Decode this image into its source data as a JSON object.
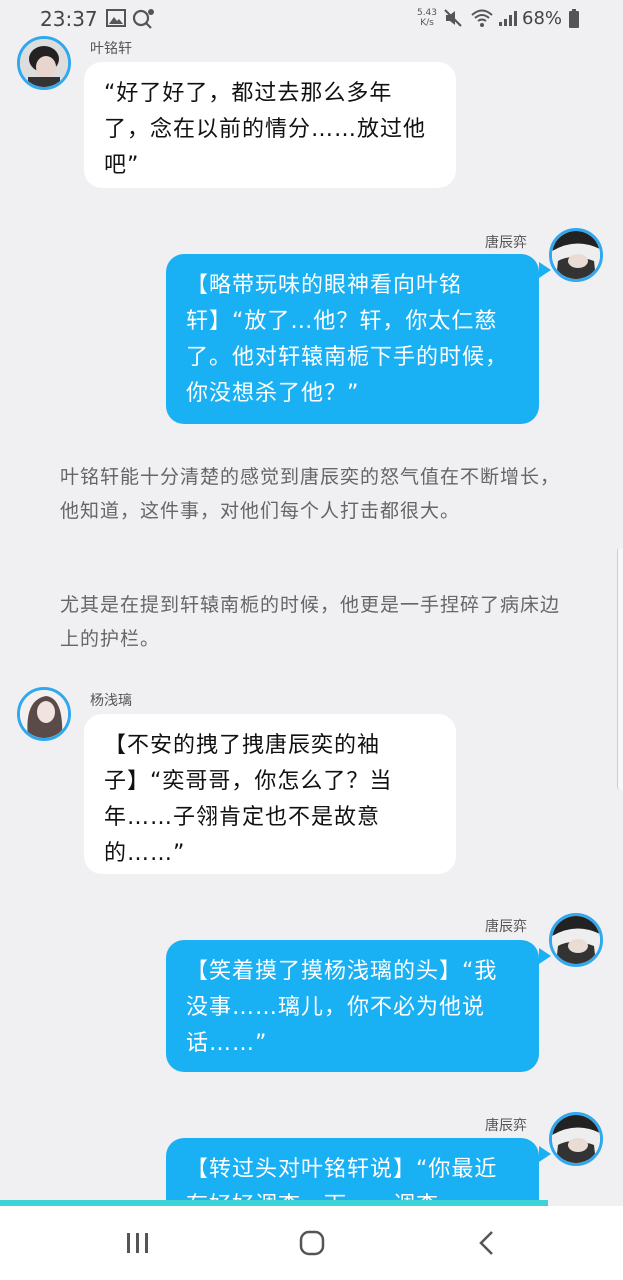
{
  "status_bar": {
    "time": "23:37",
    "net_speed_value": "5.43",
    "net_speed_unit": "K/s",
    "battery": "68%",
    "icons": [
      "image-icon",
      "search-icon",
      "mute-icon",
      "wifi-icon",
      "signal-icon",
      "battery-icon"
    ]
  },
  "messages": [
    {
      "side": "left",
      "speaker": "叶铭轩",
      "text": "“好了好了，都过去那么多年了，念在以前的情分……放过他吧”"
    },
    {
      "side": "right",
      "speaker": "唐辰弈",
      "text": "【略带玩味的眼神看向叶铭轩】“放了…他？轩，你太仁慈了。他对轩辕南栀下手的时候，你没想杀了他？”"
    },
    {
      "side": "left",
      "speaker": "杨浅璃",
      "text": "【不安的拽了拽唐辰奕的袖子】“奕哥哥，你怎么了？当年……子翎肯定也不是故意的……”"
    },
    {
      "side": "right",
      "speaker": "唐辰弈",
      "text": "【笑着摸了摸杨浅璃的头】“我没事……璃儿，你不必为他说话……”"
    },
    {
      "side": "right",
      "speaker": "唐辰弈",
      "text": "【转过头对叶铭轩说】“你最近有好好调查一下……调查"
    }
  ],
  "narration": [
    "叶铭轩能十分清楚的感觉到唐辰奕的怒气值在不断增长，他知道，这件事，对他们每个人打击都很大。",
    "尤其是在提到轩辕南栀的时候，他更是一手捏碎了病床边上的护栏。"
  ],
  "colors": {
    "background": "#f0f0f2",
    "right_bubble": "#1ab0f4",
    "left_bubble": "#ffffff",
    "avatar_ring": "#2fa8f0",
    "accent_bar": "#3fd3d6"
  },
  "nav_bar": {
    "buttons": [
      "recent-apps-icon",
      "home-icon",
      "back-icon"
    ]
  }
}
